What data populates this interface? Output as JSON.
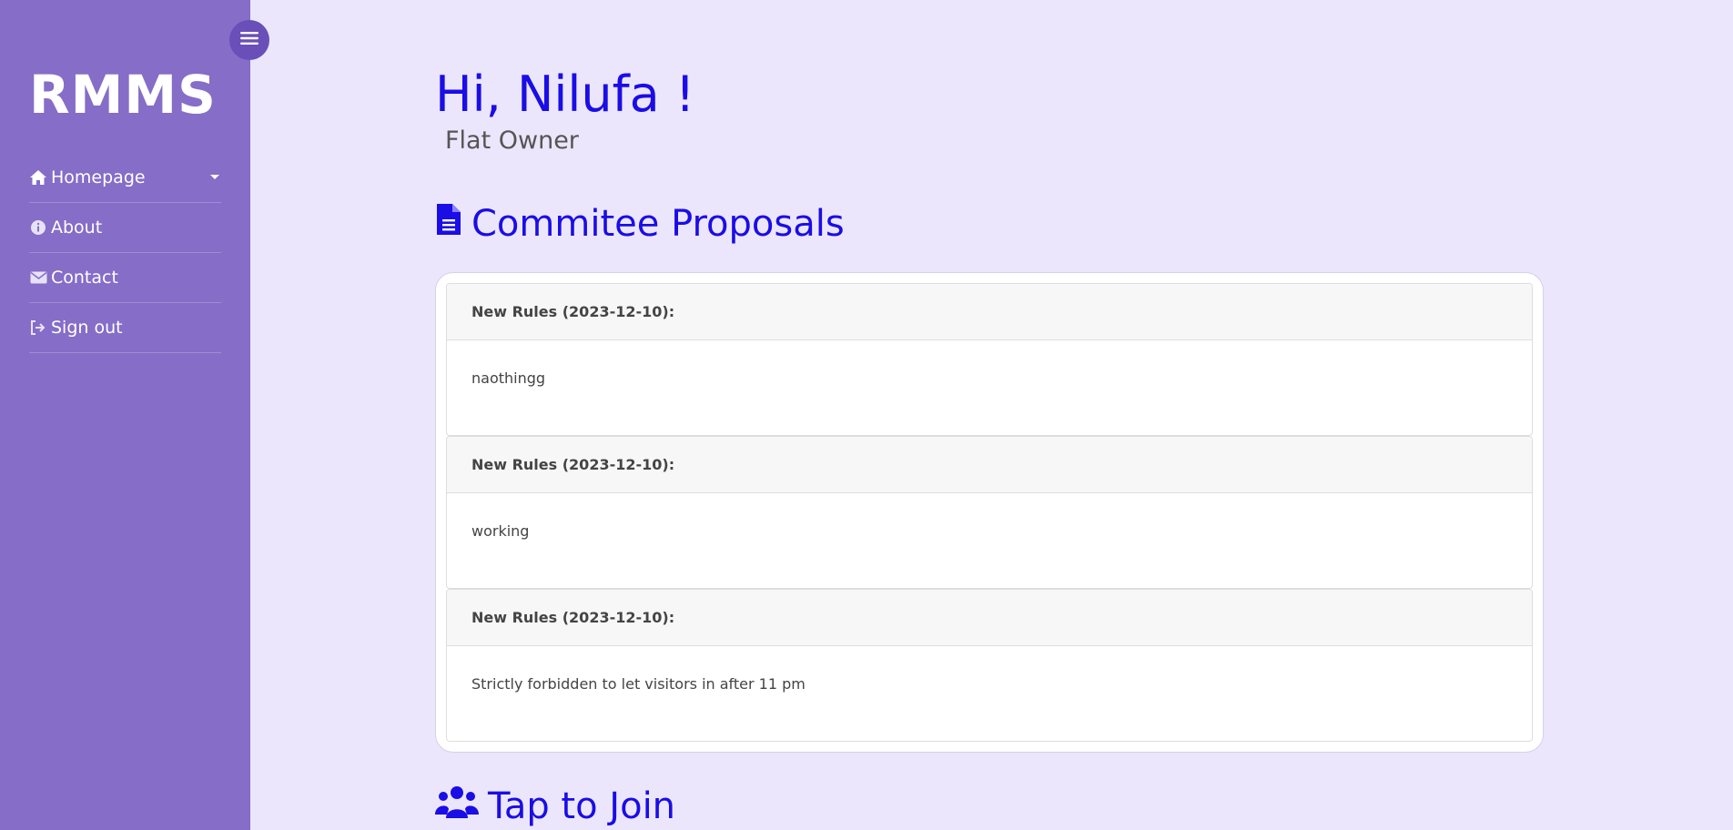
{
  "sidebar": {
    "brand": "RMMS",
    "items": [
      {
        "label": "Homepage",
        "icon": "home-icon"
      },
      {
        "label": "About",
        "icon": "info-icon"
      },
      {
        "label": "Contact",
        "icon": "envelope-icon"
      },
      {
        "label": "Sign out",
        "icon": "sign-out-icon"
      }
    ],
    "toggle_icon": "menu-icon"
  },
  "main": {
    "greeting": "Hi, Nilufa !",
    "role": "Flat Owner",
    "proposals_title": "Commitee Proposals",
    "proposals": [
      {
        "title": "New Rules (2023-12-10):",
        "body": "naothingg"
      },
      {
        "title": "New Rules (2023-12-10):",
        "body": "working"
      },
      {
        "title": "New Rules (2023-12-10):",
        "body": "Strictly forbidden to let visitors in after 11 pm"
      }
    ],
    "join_title": "Tap to Join"
  },
  "colors": {
    "sidebar_bg": "#856dc8",
    "page_bg": "#ece6fc",
    "accent": "#1a0de6"
  }
}
